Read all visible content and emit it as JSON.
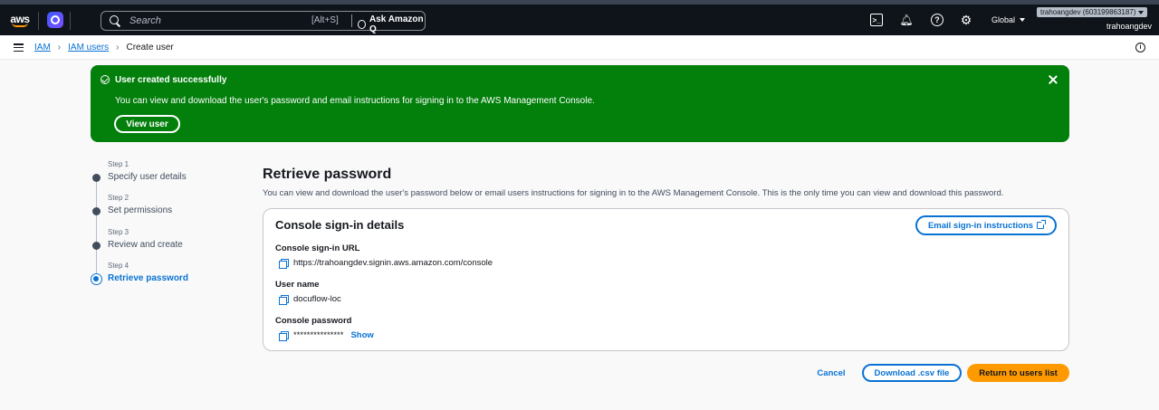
{
  "topbar": {
    "logo_text": "aws",
    "search_placeholder": "Search",
    "search_shortcut": "[Alt+S]",
    "ask_q_label": "Ask Amazon Q",
    "region": "Global",
    "account_badge": "trahoangdev (603199863187)",
    "account_name": "trahoangdev"
  },
  "breadcrumb": {
    "items": [
      "IAM",
      "IAM users",
      "Create user"
    ]
  },
  "flash": {
    "title": "User created successfully",
    "message": "You can view and download the user's password and email instructions for signing in to the AWS Management Console.",
    "view_button": "View user",
    "color": "#037f0c"
  },
  "steps": [
    {
      "number": "Step 1",
      "label": "Specify user details"
    },
    {
      "number": "Step 2",
      "label": "Set permissions"
    },
    {
      "number": "Step 3",
      "label": "Review and create"
    },
    {
      "number": "Step 4",
      "label": "Retrieve password"
    }
  ],
  "main": {
    "title": "Retrieve password",
    "description": "You can view and download the user's password below or email users instructions for signing in to the AWS Management Console. This is the only time you can view and download this password."
  },
  "card": {
    "title": "Console sign-in details",
    "email_button": "Email sign-in instructions",
    "fields": [
      {
        "label": "Console sign-in URL",
        "value": "https://trahoangdev.signin.aws.amazon.com/console"
      },
      {
        "label": "User name",
        "value": "docuflow-loc"
      },
      {
        "label": "Console password",
        "value": "***************",
        "show_link": "Show"
      }
    ]
  },
  "footer": {
    "cancel": "Cancel",
    "download_csv": "Download .csv file",
    "return": "Return to users list"
  },
  "colors": {
    "link": "#0972d3",
    "primary_button": "#ff9900",
    "nav_background": "#0f141a"
  }
}
